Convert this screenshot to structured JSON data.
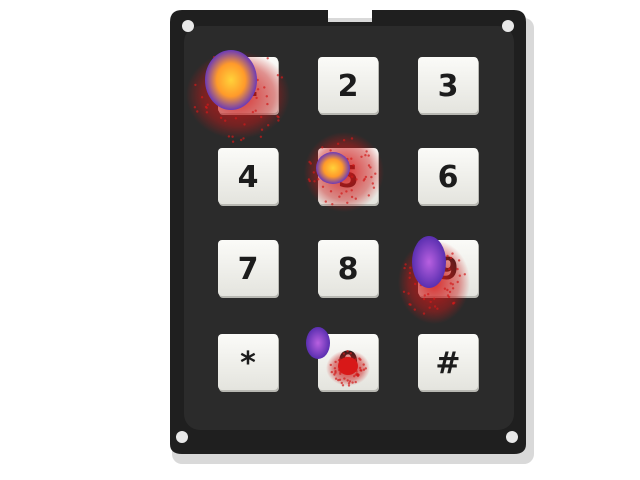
{
  "keypad": {
    "keys": [
      "1",
      "2",
      "3",
      "4",
      "5",
      "6",
      "7",
      "8",
      "9",
      "*",
      "0",
      "#"
    ]
  },
  "colors": {
    "panel": "#222222",
    "panel_inner": "#2a2a2a",
    "bezel": "#1a1a1a",
    "key_face": "#f2f2ee",
    "key_shadow": "#b8b8b2",
    "label": "#1c1c1c",
    "heat_red": "#d21a1a",
    "heat_orange": "#ffb020",
    "heat_purple": "#7a3fc0"
  },
  "heatmap": {
    "hotspot_keys": [
      "1",
      "5",
      "9",
      "*",
      "0"
    ]
  }
}
